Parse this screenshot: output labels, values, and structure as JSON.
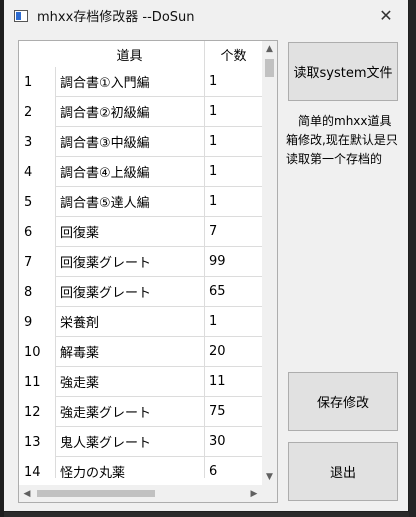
{
  "window": {
    "title": "mhxx存档修改器 --DoSun",
    "close_glyph": "✕"
  },
  "table": {
    "headers": {
      "row_number": "",
      "item": "道具",
      "count": "个数"
    },
    "rows": [
      {
        "no": "1",
        "item": "調合書①入門編",
        "count": "1"
      },
      {
        "no": "2",
        "item": "調合書②初級編",
        "count": "1"
      },
      {
        "no": "3",
        "item": "調合書③中級編",
        "count": "1"
      },
      {
        "no": "4",
        "item": "調合書④上級編",
        "count": "1"
      },
      {
        "no": "5",
        "item": "調合書⑤達人編",
        "count": "1"
      },
      {
        "no": "6",
        "item": "回復薬",
        "count": "7"
      },
      {
        "no": "7",
        "item": "回復薬グレート",
        "count": "99"
      },
      {
        "no": "8",
        "item": "回復薬グレート",
        "count": "65"
      },
      {
        "no": "9",
        "item": "栄養剤",
        "count": "1"
      },
      {
        "no": "10",
        "item": "解毒薬",
        "count": "20"
      },
      {
        "no": "11",
        "item": "強走薬",
        "count": "11"
      },
      {
        "no": "12",
        "item": "強走薬グレート",
        "count": "75"
      },
      {
        "no": "13",
        "item": "鬼人薬グレート",
        "count": "30"
      },
      {
        "no": "14",
        "item": "怪力の丸薬",
        "count": "6"
      }
    ]
  },
  "buttons": {
    "read": "读取system文件",
    "save": "保存修改",
    "exit": "退出"
  },
  "description": "简单的mhxx道具箱修改,现在默认是只读取第一个存档的",
  "icons": {
    "scroll_up": "▲",
    "scroll_down": "▼",
    "scroll_left": "◀",
    "scroll_right": "▶"
  }
}
